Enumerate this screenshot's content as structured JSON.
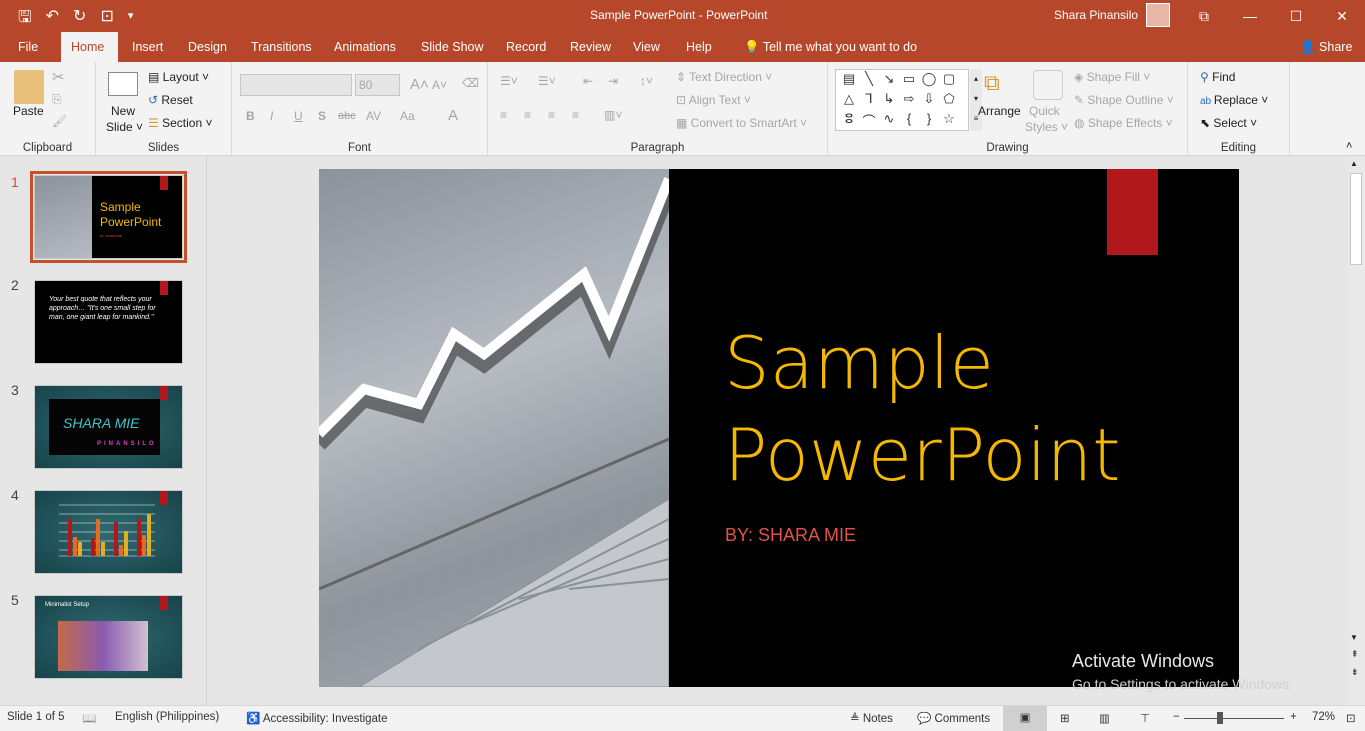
{
  "window": {
    "title": "Sample PowerPoint  -  PowerPoint",
    "user": "Shara Pinansilo",
    "restore_label": "⧉",
    "minimize": "—",
    "maximize": "☐",
    "close": "✕"
  },
  "qat": {
    "save": "🖫",
    "undo": "↶",
    "redo": "↻",
    "present": "⊡",
    "more": "▾"
  },
  "tabs": [
    "File",
    "Home",
    "Insert",
    "Design",
    "Transitions",
    "Animations",
    "Slide Show",
    "Record",
    "Review",
    "View",
    "Help"
  ],
  "tell_me": "Tell me what you want to do",
  "share": "Share",
  "ribbon": {
    "clipboard": {
      "label": "Clipboard",
      "paste": "Paste"
    },
    "slides": {
      "label": "Slides",
      "new_slide": "New",
      "new_slide2": "Slide ˅",
      "layout": "Layout ˅",
      "reset": "Reset",
      "section": "Section ˅"
    },
    "font": {
      "label": "Font",
      "font_name": "",
      "font_size": "80",
      "bold": "B",
      "italic": "I",
      "underline": "U",
      "shadow": "S",
      "strike": "abc",
      "spacing": "AV",
      "case": "Aa",
      "color": "A",
      "grow": "A˄",
      "shrink": "A˅"
    },
    "paragraph": {
      "label": "Paragraph",
      "text_direction": "Text Direction ˅",
      "align_text": "Align Text ˅",
      "convert_smartart": "Convert to SmartArt ˅"
    },
    "drawing": {
      "label": "Drawing",
      "arrange": "Arrange",
      "quick_styles": "Quick",
      "quick_styles2": "Styles ˅",
      "shape_fill": "Shape Fill ˅",
      "shape_outline": "Shape Outline ˅",
      "shape_effects": "Shape Effects ˅",
      "shapes": [
        "▤",
        "╲",
        "↘",
        "▭",
        "◯",
        "▢",
        "△",
        "⅂",
        "↳",
        "⇨",
        "⇩",
        "⬠",
        "ⵓ",
        "⌒",
        "∿",
        "{",
        "}",
        "☆"
      ]
    },
    "editing": {
      "label": "Editing",
      "find": "Find",
      "replace": "Replace ˅",
      "select": "Select ˅"
    }
  },
  "thumbnails": [
    {
      "num": "1",
      "title": "Sample PowerPoint",
      "sub": "BY: SHARA MIE"
    },
    {
      "num": "2",
      "text": "Your best quote that reflects your approach… \"It's one small step for man, one giant leap for mankind.\""
    },
    {
      "num": "3",
      "text1": "SHARA MIE",
      "text2": "PINANSILO"
    },
    {
      "num": "4"
    },
    {
      "num": "5",
      "title": "Minimalist Setup"
    }
  ],
  "slide": {
    "title1": "Sample",
    "title2": "PowerPoint",
    "subtitle": "BY: SHARA MIE",
    "title_color": "#f5b800",
    "accent": "#b0181b"
  },
  "watermark": {
    "line1": "Activate Windows",
    "line2": "Go to Settings to activate Windows."
  },
  "status": {
    "slide": "Slide 1 of 5",
    "language": "English (Philippines)",
    "accessibility": "Accessibility: Investigate",
    "notes": "Notes",
    "comments": "Comments",
    "zoom": "72%"
  }
}
